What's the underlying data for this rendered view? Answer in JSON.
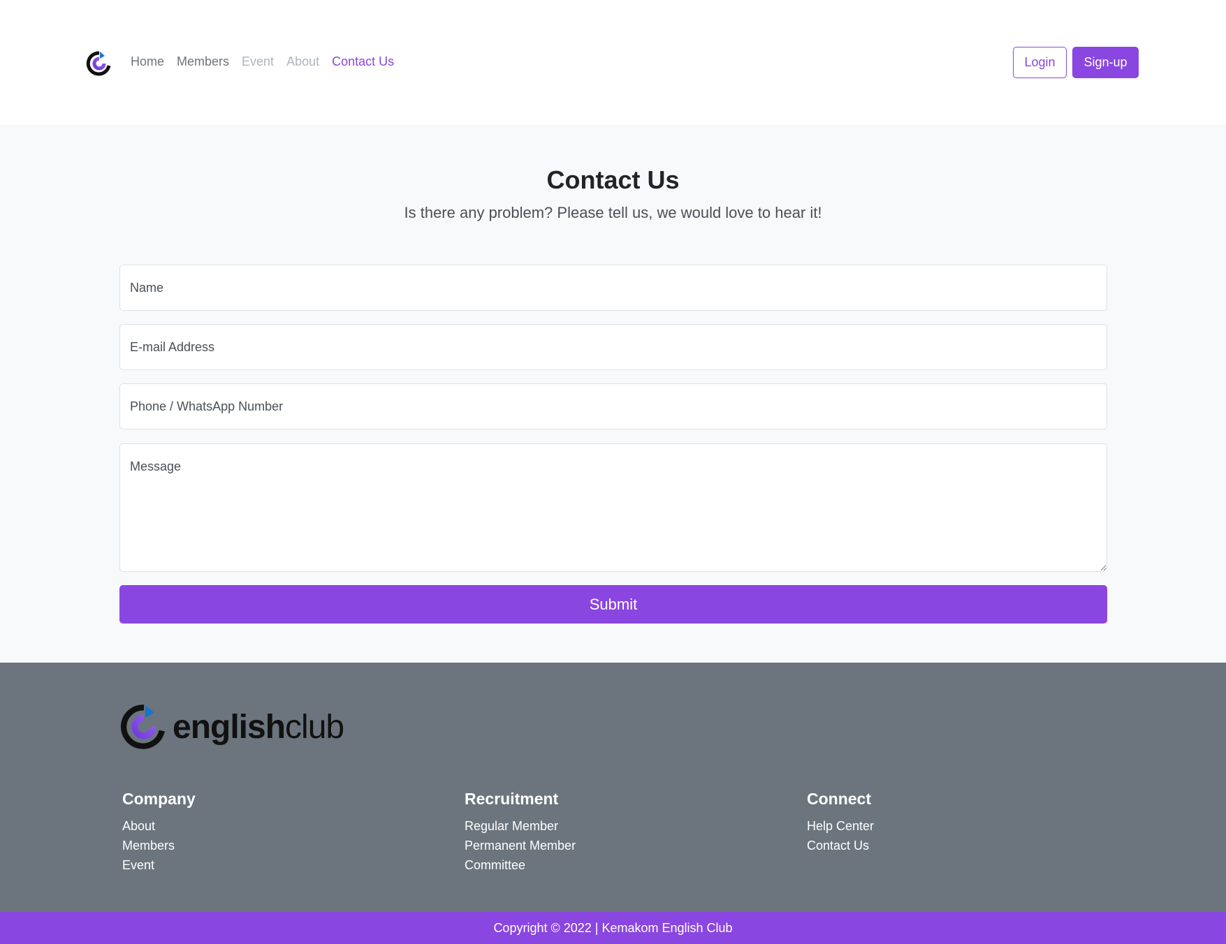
{
  "nav": {
    "links": [
      {
        "label": "Home"
      },
      {
        "label": "Members"
      },
      {
        "label": "Event"
      },
      {
        "label": "About"
      },
      {
        "label": "Contact Us"
      }
    ],
    "login_label": "Login",
    "signup_label": "Sign-up"
  },
  "contact": {
    "title": "Contact Us",
    "subtitle": "Is there any problem? Please tell us, we would love to hear it!",
    "name_placeholder": "Name",
    "email_placeholder": "E-mail Address",
    "phone_placeholder": "Phone / WhatsApp Number",
    "message_placeholder": "Message",
    "submit_label": "Submit"
  },
  "footer": {
    "brand_bold": "english",
    "brand_light": "club",
    "columns": [
      {
        "heading": "Company",
        "links": [
          "About",
          "Members",
          "Event"
        ]
      },
      {
        "heading": "Recruitment",
        "links": [
          "Regular Member",
          "Permanent Member",
          "Committee"
        ]
      },
      {
        "heading": "Connect",
        "links": [
          "Help Center",
          "Contact Us"
        ]
      }
    ],
    "copyright": "Copyright © 2022 | Kemakom English Club"
  },
  "colors": {
    "accent": "#8a46e0",
    "footer_bg": "#6c757d",
    "main_bg": "#f8f9fa"
  },
  "icons": {
    "nav_logo": "englishclub-logo-icon",
    "footer_logo": "englishclub-logo-icon",
    "resize_handle": "resize-grip-icon"
  }
}
